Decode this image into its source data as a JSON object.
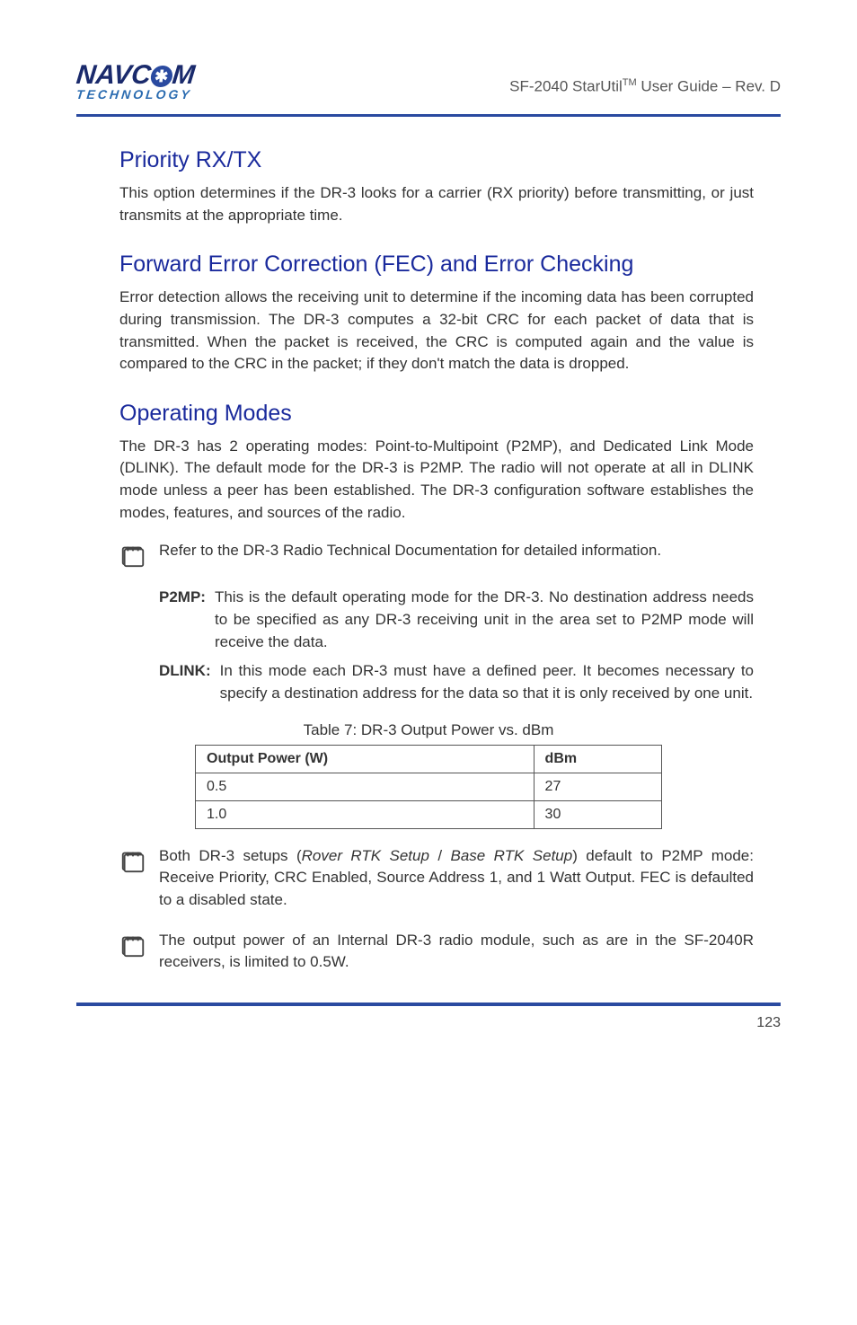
{
  "header": {
    "logo_line1_pre": "NAVC",
    "logo_line1_post": "M",
    "logo_line2": "TECHNOLOGY",
    "product_pre": "SF-2040 StarUtil",
    "product_tm": "TM",
    "product_post": " User Guide ",
    "product_rev": "– Rev. D"
  },
  "sections": {
    "priority": {
      "heading": "Priority RX/TX",
      "body": "This option determines if the DR-3 looks for a carrier (RX priority) before transmitting, or just transmits at the appropriate time."
    },
    "fec": {
      "heading": "Forward Error Correction (FEC) and Error Checking",
      "body": "Error detection allows the receiving unit to determine if the incoming data has been corrupted during transmission. The DR-3 computes a 32-bit CRC for each packet of data that is transmitted. When the packet is received, the CRC is computed again and the value is compared to the CRC in the packet; if they don't match the data is dropped."
    },
    "modes": {
      "heading": "Operating Modes",
      "body1": "The DR-3 has 2 operating modes: Point-to-Multipoint (P2MP), and Dedicated Link Mode (DLINK). The default mode for the DR-3 is P2MP. The radio will not operate at all in DLINK mode unless a peer has been established. The DR-3 configuration software establishes the modes, features, and sources of the radio.",
      "note1": "Refer to the DR-3 Radio Technical Documentation for detailed information.",
      "item1_lead": "P2MP:",
      "item1_body": "This is the default operating mode for the DR-3. No destination address needs to be specified as any DR-3 receiving unit in the area set to P2MP mode will receive the data.",
      "item2_lead": "DLINK:",
      "item2_body": "In this mode each DR-3 must have a defined peer. It becomes necessary to specify a destination address for the data so that it is only received by one unit."
    },
    "table": {
      "caption": "Table 7: DR-3 Output Power vs. dBm",
      "col1h": "Output Power (W)",
      "col2h": "dBm",
      "r1c1": "0.5",
      "r1c2": "27",
      "r2c1": "1.0",
      "r2c2": "30"
    },
    "notes": {
      "n2_lead_pre": "Both DR-3 setups (",
      "n2_lead_ti": "Rover RTK Setup",
      "n2_lead_mid": " / ",
      "n2_lead_bi": "Base RTK Setup",
      "n2_lead_post": ") default to P2MP mode: Receive Priority, CRC Enabled, Source Address 1, and 1 Watt Output. FEC is defaulted to a disabled state.",
      "n3": "The output power of an Internal DR-3 radio module, such as are in the SF-2040R receivers, is limited to 0.5W."
    }
  },
  "footer": {
    "page": "123"
  }
}
